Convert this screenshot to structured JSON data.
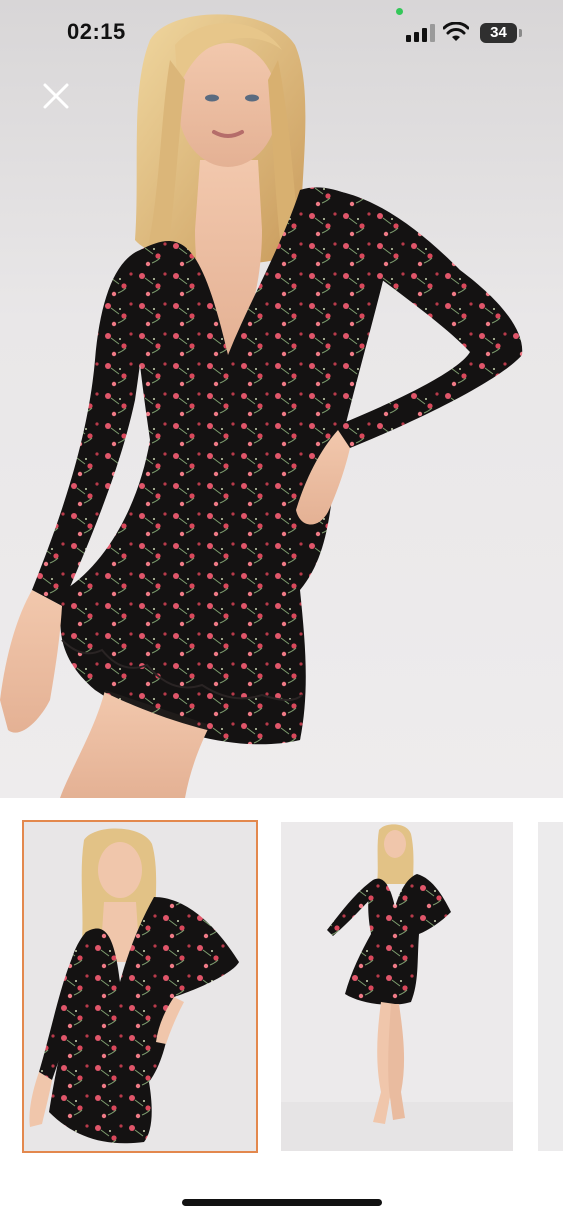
{
  "status_bar": {
    "time": "02:15",
    "battery_level": "34",
    "colors": {
      "privacy_dot": "#34c759"
    },
    "icons": [
      "signal-bars-icon",
      "wifi-icon",
      "battery-icon"
    ]
  },
  "close_icon": "close-icon",
  "gallery": {
    "main_image": "model-wearing-floral-long-sleeve-mini-dress-closeup",
    "thumbnails": [
      {
        "label": "closeup",
        "selected": true
      },
      {
        "label": "full-length",
        "selected": false
      },
      {
        "label": "partial-third",
        "selected": false
      }
    ],
    "colors": {
      "selection_border": "#e3884d",
      "dress": "#141212",
      "flower": "#e0566a"
    }
  }
}
